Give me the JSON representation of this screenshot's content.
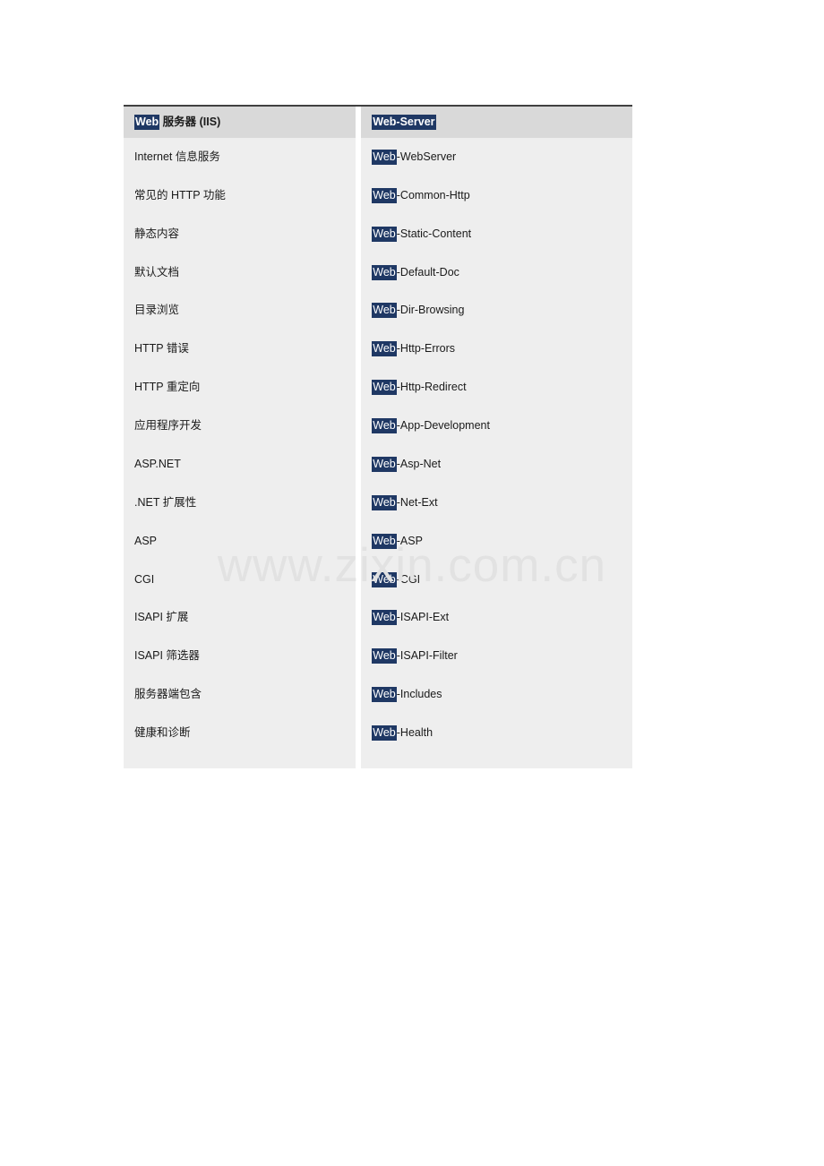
{
  "document": {
    "watermark": "www.zixin.com.cn",
    "accent_highlight_color": "#1f3864",
    "header_background_color": "#d9d9d9",
    "row_background_color": "#eeeeee",
    "text_color": "#1a1a1a"
  },
  "table": {
    "header": {
      "left": {
        "highlight": "Web",
        "rest": " 服务器 (IIS)"
      },
      "right": {
        "highlight": "Web-Server",
        "rest": ""
      }
    },
    "rows": [
      {
        "left": "Internet 信息服务",
        "right_highlight": "Web",
        "right_rest": "-WebServer"
      },
      {
        "left": "常见的 HTTP 功能",
        "right_highlight": "Web",
        "right_rest": "-Common-Http"
      },
      {
        "left": "静态内容",
        "right_highlight": "Web",
        "right_rest": "-Static-Content"
      },
      {
        "left": "默认文档",
        "right_highlight": "Web",
        "right_rest": "-Default-Doc"
      },
      {
        "left": "目录浏览",
        "right_highlight": "Web",
        "right_rest": "-Dir-Browsing"
      },
      {
        "left": "HTTP 错误",
        "right_highlight": "Web",
        "right_rest": "-Http-Errors"
      },
      {
        "left": "HTTP 重定向",
        "right_highlight": "Web",
        "right_rest": "-Http-Redirect"
      },
      {
        "left": "应用程序开发",
        "right_highlight": "Web",
        "right_rest": "-App-Development"
      },
      {
        "left": "ASP.NET",
        "right_highlight": "Web",
        "right_rest": "-Asp-Net"
      },
      {
        "left": ".NET 扩展性",
        "right_highlight": "Web",
        "right_rest": "-Net-Ext"
      },
      {
        "left": "ASP",
        "right_highlight": "Web",
        "right_rest": "-ASP"
      },
      {
        "left": "CGI",
        "right_highlight": "Web",
        "right_rest": "-CGI"
      },
      {
        "left": "ISAPI 扩展",
        "right_highlight": "Web",
        "right_rest": "-ISAPI-Ext"
      },
      {
        "left": "ISAPI 筛选器",
        "right_highlight": "Web",
        "right_rest": "-ISAPI-Filter"
      },
      {
        "left": "服务器端包含",
        "right_highlight": "Web",
        "right_rest": "-Includes"
      },
      {
        "left": "健康和诊断",
        "right_highlight": "Web",
        "right_rest": "-Health"
      }
    ]
  }
}
